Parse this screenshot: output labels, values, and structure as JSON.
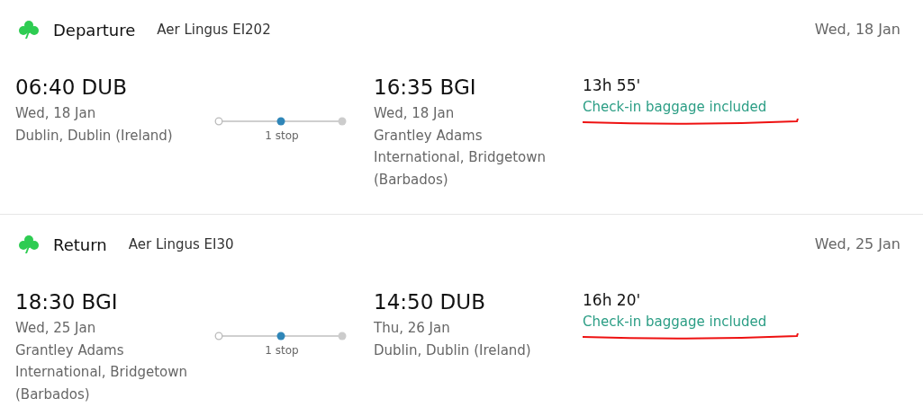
{
  "legs": [
    {
      "label": "Departure",
      "airline": "Aer Lingus EI202",
      "date": "Wed, 18 Jan",
      "departure": {
        "time": "06:40 DUB",
        "date": "Wed, 18 Jan",
        "place": "Dublin, Dublin (Ireland)"
      },
      "stops": "1 stop",
      "arrival": {
        "time": "16:35 BGI",
        "date": "Wed, 18 Jan",
        "place": "Grantley Adams International, Bridgetown (Barbados)"
      },
      "duration": "13h 55'",
      "baggage": "Check-in baggage included"
    },
    {
      "label": "Return",
      "airline": "Aer Lingus EI30",
      "date": "Wed, 25 Jan",
      "departure": {
        "time": "18:30 BGI",
        "date": "Wed, 25 Jan",
        "place": "Grantley Adams International, Bridgetown (Barbados)"
      },
      "stops": "1 stop",
      "arrival": {
        "time": "14:50 DUB",
        "date": "Thu, 26 Jan",
        "place": "Dublin, Dublin (Ireland)"
      },
      "duration": "16h 20'",
      "baggage": "Check-in baggage included"
    }
  ]
}
